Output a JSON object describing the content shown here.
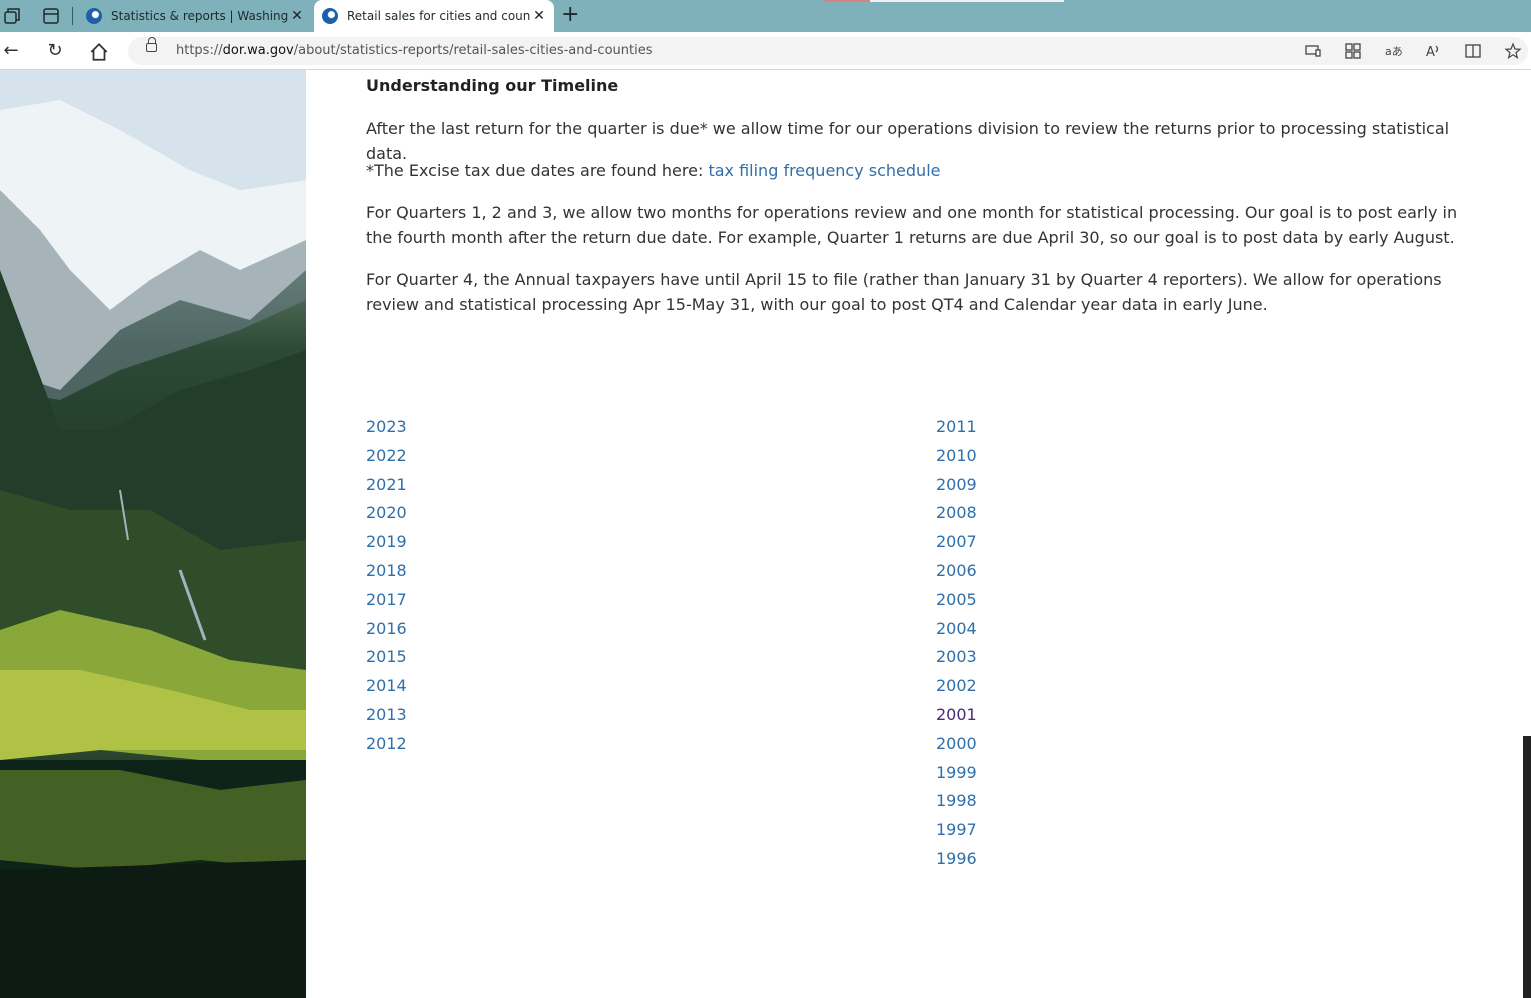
{
  "browser": {
    "tabs": [
      {
        "title": "Statistics & reports | Washington",
        "active": false
      },
      {
        "title": "Retail sales for cities and countie",
        "active": true
      }
    ],
    "url_domain": "dor.wa.gov",
    "url_prefix": "https://",
    "url_path": "/about/statistics-reports/retail-sales-cities-and-counties",
    "close_glyph": "✕",
    "new_tab_glyph": "+"
  },
  "content": {
    "heading": "Understanding our Timeline",
    "p1": "After the last return for the quarter is due* we allow time for our operations division to review the returns prior to processing statistical data.",
    "p2_text": "*The Excise tax due dates are found here: ",
    "p2_link": "tax filing frequency schedule",
    "p3": "For Quarters 1, 2 and 3, we allow two months for operations review and one month for statistical processing. Our goal is to post early in the fourth month after the return due date. For example, Quarter 1 returns are due April 30, so our goal is to post data by early August.",
    "p4": "For Quarter 4, the Annual taxpayers have until April 15 to file (rather than January 31 by Quarter 4 reporters). We allow for operations review and statistical processing Apr 15-May 31, with our goal to post QT4 and Calendar year data in early June."
  },
  "years_left": [
    "2023",
    "2022",
    "2021",
    "2020",
    "2019",
    "2018",
    "2017",
    "2016",
    "2015",
    "2014",
    "2013",
    "2012"
  ],
  "years_right": [
    "2011",
    "2010",
    "2009",
    "2008",
    "2007",
    "2006",
    "2005",
    "2004",
    "2003",
    "2002",
    "2001",
    "2000",
    "1999",
    "1998",
    "1997",
    "1996"
  ],
  "colors": {
    "link": "#2f6fab",
    "visited": "#4b2a7a",
    "tabbar": "#7eb1b9"
  }
}
